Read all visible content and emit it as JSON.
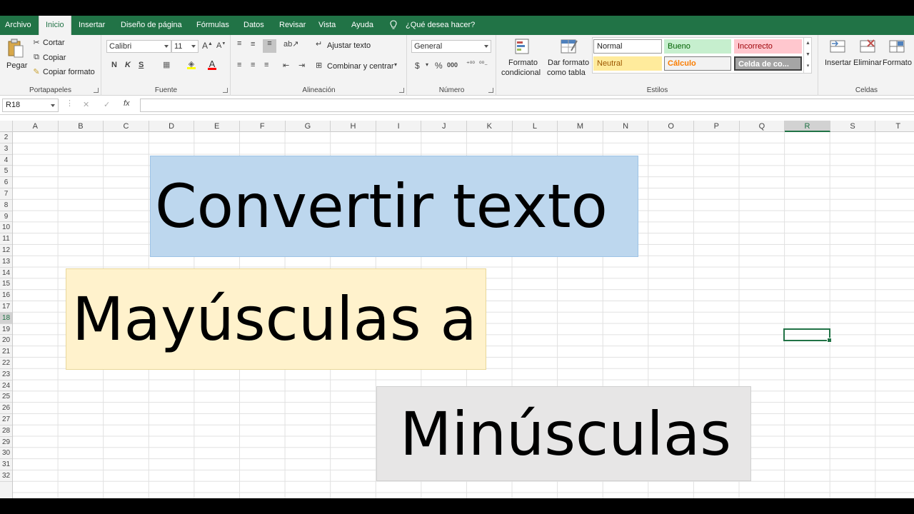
{
  "tabs": [
    "Archivo",
    "Inicio",
    "Insertar",
    "Diseño de página",
    "Fórmulas",
    "Datos",
    "Revisar",
    "Vista",
    "Ayuda"
  ],
  "tell_me": "¿Qué desea hacer?",
  "clipboard": {
    "paste": "Pegar",
    "cut": "Cortar",
    "copy": "Copiar",
    "format_painter": "Copiar formato",
    "label": "Portapapeles"
  },
  "font": {
    "name": "Calibri",
    "size": "11",
    "bold": "N",
    "italic": "K",
    "underline": "S",
    "label": "Fuente"
  },
  "alignment": {
    "wrap": "Ajustar texto",
    "merge": "Combinar y centrar",
    "label": "Alineación"
  },
  "number": {
    "format": "General",
    "currency": "$",
    "percent": "%",
    "comma": "000",
    "label": "Número"
  },
  "styles": {
    "conditional": [
      "Formato",
      "condicional"
    ],
    "as_table": [
      "Dar formato",
      "como tabla"
    ],
    "normal": "Normal",
    "good": "Bueno",
    "bad": "Incorrecto",
    "neutral": "Neutral",
    "calc": "Cálculo",
    "check": "Celda de co...",
    "label": "Estilos",
    "colors": {
      "good_bg": "#c6efce",
      "good_fg": "#006100",
      "bad_bg": "#ffc7ce",
      "bad_fg": "#9c0006",
      "neutral_bg": "#ffeb9c",
      "neutral_fg": "#9c5700",
      "calc_bg": "#f2f2f2",
      "calc_fg": "#fa7d00",
      "check_bg": "#a5a5a5"
    }
  },
  "cells_group": {
    "insert": "Insertar",
    "delete": "Eliminar",
    "format": "Formato",
    "label": "Celdas"
  },
  "formula_bar": {
    "name_box": "R18",
    "cancel": "✕",
    "enter": "✓",
    "fx": "fx"
  },
  "columns": [
    "A",
    "B",
    "C",
    "D",
    "E",
    "F",
    "G",
    "H",
    "I",
    "J",
    "K",
    "L",
    "M",
    "N",
    "O",
    "P",
    "Q",
    "R",
    "S",
    "T"
  ],
  "rows": [
    "2",
    "3",
    "4",
    "5",
    "6",
    "7",
    "8",
    "9",
    "10",
    "11",
    "12",
    "13",
    "14",
    "15",
    "16",
    "17",
    "18",
    "19",
    "20",
    "21",
    "22",
    "23",
    "24",
    "25",
    "26",
    "27",
    "28",
    "29",
    "30",
    "31",
    "32"
  ],
  "selected": {
    "column": "R",
    "row": "18"
  },
  "banners": [
    {
      "text": "Convertir texto",
      "bg": "#bdd7ee"
    },
    {
      "text": "Mayúsculas a",
      "bg": "#fff2cc"
    },
    {
      "text": "Minúsculas",
      "bg": "#e7e6e6"
    }
  ],
  "accent": "#217346"
}
